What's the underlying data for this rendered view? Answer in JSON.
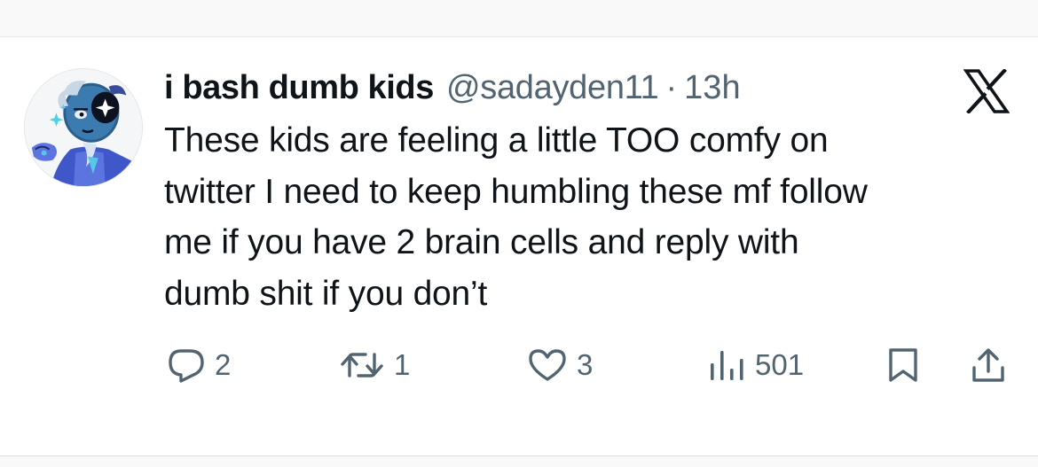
{
  "tweet": {
    "author": {
      "display_name": "i bash dumb kids",
      "handle": "@sadayden11",
      "separator": "·",
      "time": "13h",
      "avatar_icon": "cartoon-character-avatar-icon"
    },
    "text_lines": [
      "These kids are feeling a little TOO comfy on",
      "twitter I need to keep humbling these mf follow",
      "me if you have 2 brain cells and reply with",
      "dumb shit if you don’t"
    ],
    "platform_logo": "x-logo-icon"
  },
  "actions": {
    "reply": {
      "icon": "reply-icon",
      "count": "2"
    },
    "retweet": {
      "icon": "retweet-icon",
      "count": "1"
    },
    "like": {
      "icon": "heart-icon",
      "count": "3"
    },
    "views": {
      "icon": "views-icon",
      "count": "501"
    },
    "bookmark": {
      "icon": "bookmark-icon"
    },
    "share": {
      "icon": "share-icon"
    }
  },
  "colors": {
    "text": "#0f1419",
    "secondary": "#536471",
    "background": "#ffffff"
  }
}
